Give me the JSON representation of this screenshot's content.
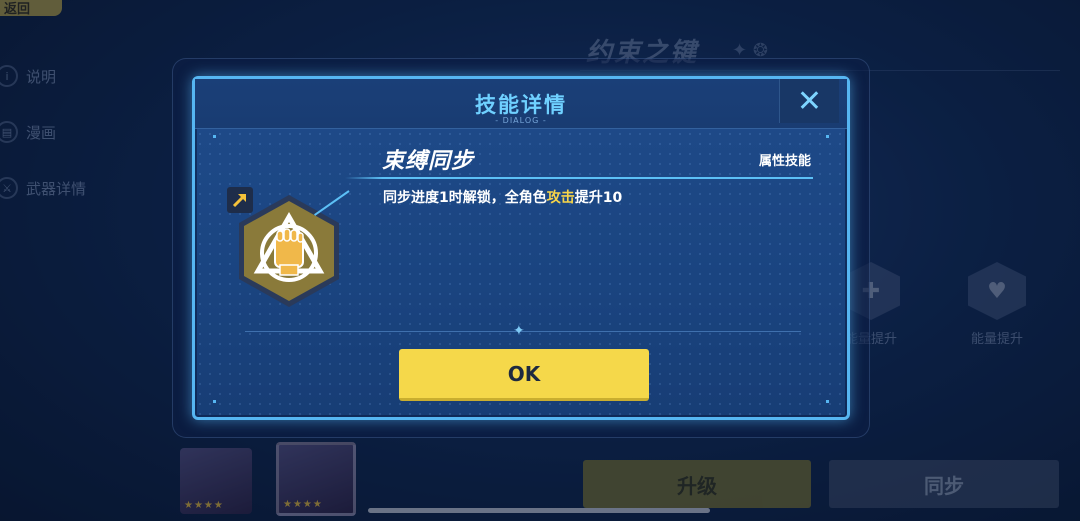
{
  "background": {
    "back_label": "返回",
    "side_menu": [
      {
        "icon": "info-icon",
        "label": "说明"
      },
      {
        "icon": "comic-icon",
        "label": "漫画"
      },
      {
        "icon": "weapon-icon",
        "label": "武器详情"
      }
    ],
    "weapon_name": "约束之键",
    "skills": [
      {
        "label": "能量提升"
      },
      {
        "label": "能量提升"
      }
    ],
    "upgrade_label": "升级",
    "sync_label": "同步",
    "char_cards": [
      {
        "stars": "★★★★"
      },
      {
        "stars": "★★★★"
      }
    ]
  },
  "dialog": {
    "title": "技能详情",
    "subtitle": "- DIALOG -",
    "close_icon": "close-icon",
    "skill": {
      "name": "束缚同步",
      "type": "属性技能",
      "icon": "fist-icon",
      "desc_prefix": "同步进度1时解锁，全角色",
      "desc_highlight": "攻击",
      "desc_suffix": "提升10"
    },
    "ok_label": "OK"
  },
  "colors": {
    "accent": "#56b6f2",
    "title": "#6fd0ff",
    "highlight": "#f6d44a",
    "ok_button": "#f5d84a",
    "skill_hex": "#8a7a3a"
  }
}
